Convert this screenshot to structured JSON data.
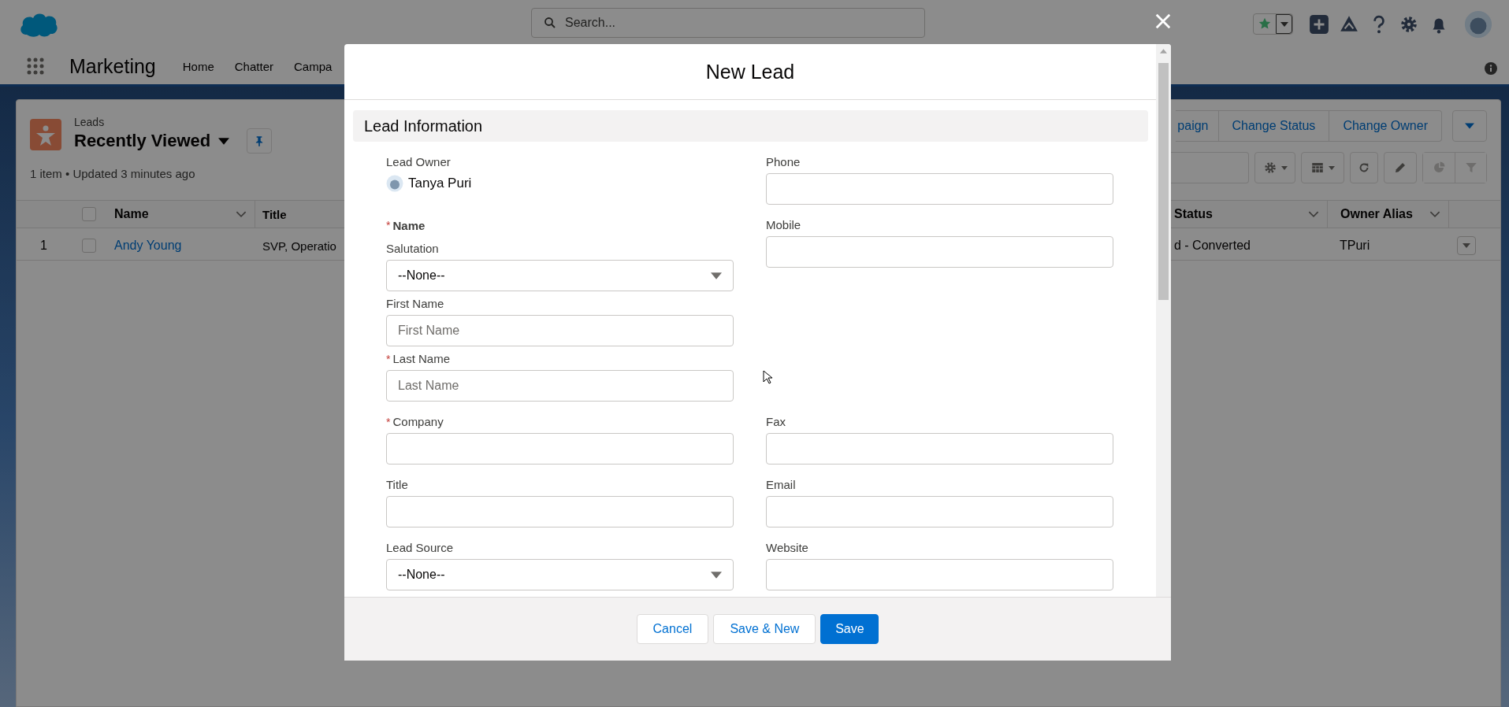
{
  "header": {
    "search_placeholder": "Search..."
  },
  "nav": {
    "app_name": "Marketing",
    "items": [
      "Home",
      "Chatter",
      "Campa"
    ]
  },
  "list_view": {
    "object_label": "Leads",
    "view_name": "Recently Viewed",
    "summary": "1 item • Updated 3 minutes ago",
    "actions": [
      "paign",
      "Change Status",
      "Change Owner"
    ],
    "all_checked": false,
    "columns_left": [
      "Name",
      "Title"
    ],
    "columns_right": [
      "Status",
      "Owner Alias"
    ],
    "rows": [
      {
        "number": "1",
        "checked": false,
        "name": "Andy Young",
        "title": "SVP, Operatio",
        "status": "d - Converted",
        "owner_alias": "TPuri"
      }
    ]
  },
  "modal": {
    "title": "New Lead",
    "section": "Lead Information",
    "rows": [
      {
        "left": {
          "kind": "owner",
          "label": "Lead Owner",
          "value": "Tanya Puri"
        },
        "right": {
          "kind": "text",
          "label": "Phone"
        }
      },
      {
        "left": {
          "kind": "group",
          "label": "Name",
          "required_mark": "*",
          "fields": [
            {
              "kind": "select",
              "label": "Salutation",
              "value": "--None--"
            },
            {
              "kind": "text",
              "label": "First Name",
              "placeholder": "First Name"
            },
            {
              "kind": "text",
              "label": "Last Name",
              "required_mark": "*",
              "placeholder": "Last Name"
            }
          ]
        },
        "right": {
          "kind": "text",
          "label": "Mobile"
        }
      },
      {
        "left": {
          "kind": "text",
          "label": "Company",
          "required_mark": "*"
        },
        "right": {
          "kind": "text",
          "label": "Fax"
        }
      },
      {
        "left": {
          "kind": "text",
          "label": "Title"
        },
        "right": {
          "kind": "text",
          "label": "Email"
        }
      },
      {
        "left": {
          "kind": "select",
          "label": "Lead Source",
          "value": "--None--"
        },
        "right": {
          "kind": "text",
          "label": "Website"
        }
      }
    ],
    "buttons": [
      {
        "label": "Cancel",
        "kind": "neutral"
      },
      {
        "label": "Save & New",
        "kind": "neutral"
      },
      {
        "label": "Save",
        "kind": "brand"
      }
    ]
  }
}
